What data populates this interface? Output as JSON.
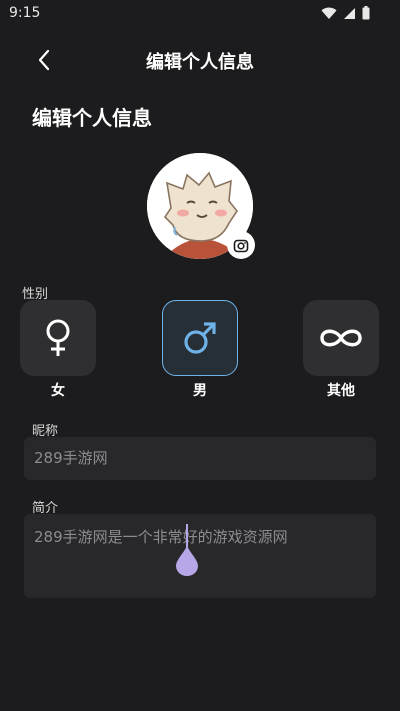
{
  "status_bar": {
    "time": "9:15",
    "icons": [
      "wifi-icon",
      "signal-icon",
      "battery-icon"
    ]
  },
  "header": {
    "title": "编辑个人信息",
    "back_icon": "chevron-left-icon"
  },
  "page": {
    "section_title": "编辑个人信息"
  },
  "avatar": {
    "badge_icon": "camera-icon"
  },
  "gender": {
    "label": "性别",
    "options": [
      {
        "label": "女",
        "icon": "female-icon",
        "selected": false
      },
      {
        "label": "男",
        "icon": "male-icon",
        "selected": true
      },
      {
        "label": "其他",
        "icon": "infinity-icon",
        "selected": false
      }
    ]
  },
  "nickname": {
    "label": "昵称",
    "value": "289手游网"
  },
  "bio": {
    "label": "简介",
    "value": "289手游网是一个非常好的游戏资源网"
  },
  "colors": {
    "background": "#1c1c1e",
    "field_background": "#28282a",
    "selected_accent": "#6fb2e8",
    "cursor": "#b7a6e8"
  }
}
